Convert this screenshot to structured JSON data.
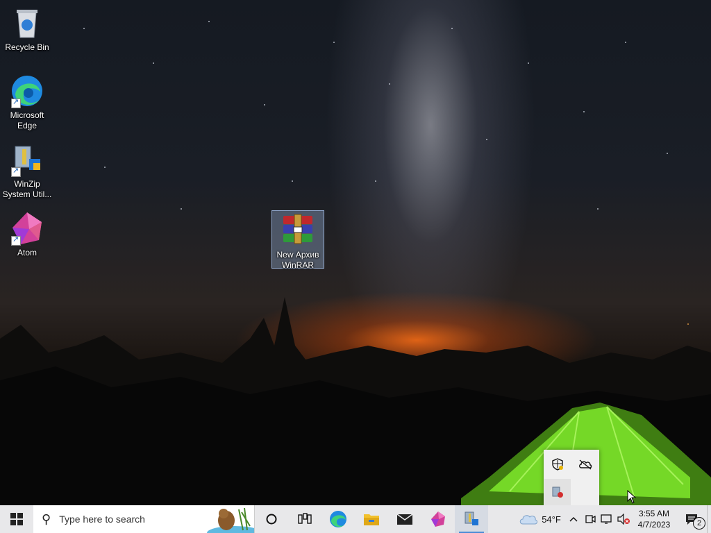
{
  "desktop": {
    "icons": [
      {
        "label_line1": "Recycle Bin",
        "label_line2": ""
      },
      {
        "label_line1": "Microsoft",
        "label_line2": "Edge"
      },
      {
        "label_line1": "WinZip",
        "label_line2": "System Util..."
      },
      {
        "label_line1": "Atom",
        "label_line2": ""
      },
      {
        "label_line1": "New Архив",
        "label_line2": "WinRAR"
      }
    ]
  },
  "taskbar": {
    "search_placeholder": "Type here to search",
    "pinned": [
      "cortana-icon",
      "task-view-icon",
      "edge-icon",
      "file-explorer-icon",
      "mail-icon",
      "atom-icon",
      "winzip-icon"
    ],
    "weather": {
      "temp": "54°F",
      "icon": "cloud-icon"
    },
    "clock": {
      "time": "3:55 AM",
      "date": "4/7/2023"
    },
    "notifications": {
      "count": "2"
    }
  },
  "colors": {
    "taskbar_bg": "#e8e8ea",
    "accent": "#4a8bd6",
    "windows_blue": "#0078d7"
  }
}
